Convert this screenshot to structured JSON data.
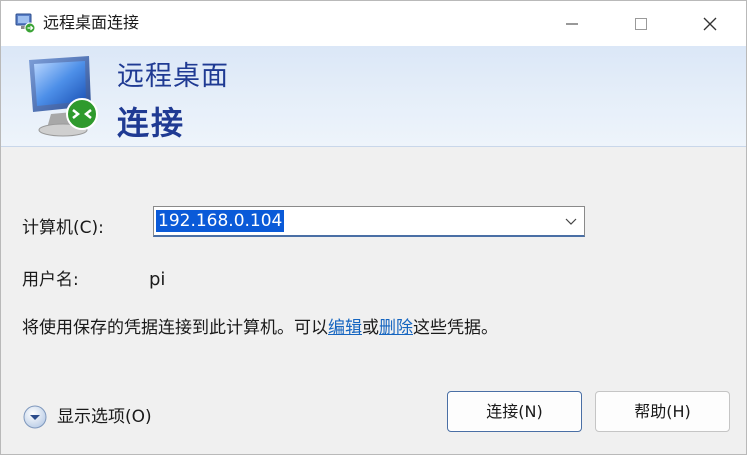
{
  "window": {
    "title": "远程桌面连接",
    "minimize_glyph": "minimize-icon",
    "maximize_glyph": "maximize-icon",
    "close_glyph": "close-icon"
  },
  "banner": {
    "line1": "远程桌面",
    "line2": "连接"
  },
  "form": {
    "computer_label": "计算机(C):",
    "computer_value": "192.168.0.104",
    "username_label": "用户名:",
    "username_value": "pi",
    "info_prefix": "将使用保存的凭据连接到此计算机。可以",
    "info_edit_link": "编辑",
    "info_or": "或",
    "info_delete_link": "删除",
    "info_suffix": "这些凭据。"
  },
  "footer": {
    "show_options_label": "显示选项(O)",
    "connect_button": "连接(N)",
    "help_button": "帮助(H)"
  },
  "colors": {
    "accent": "#1f3a93",
    "link": "#1565c0",
    "selection": "#0a5ad8"
  }
}
